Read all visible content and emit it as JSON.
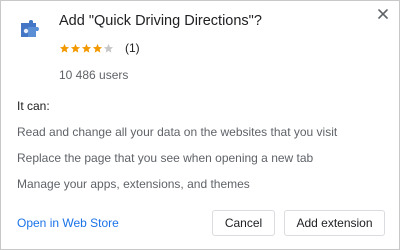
{
  "dialog": {
    "title": "Add \"Quick Driving Directions\"?",
    "close_icon": "close-icon",
    "extension_icon": "puzzle-piece-icon"
  },
  "rating": {
    "stars_filled": 4,
    "stars_total": 5,
    "count": "(1)",
    "star_color": "#f29900",
    "star_empty_color": "#c7c7c7"
  },
  "users": "10 486 users",
  "permissions": {
    "label": "It can:",
    "items": [
      "Read and change all your data on the websites that you visit",
      "Replace the page that you see when opening a new tab",
      "Manage your apps, extensions, and themes"
    ]
  },
  "footer": {
    "store_link": "Open in Web Store",
    "cancel_label": "Cancel",
    "add_label": "Add extension",
    "link_color": "#1a73e8"
  }
}
